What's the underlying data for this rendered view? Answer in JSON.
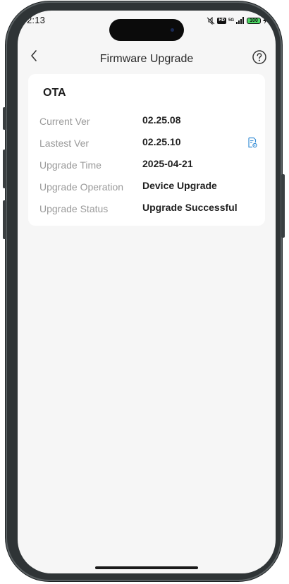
{
  "status_bar": {
    "time": "2:13",
    "network_label": "5G",
    "hd_label": "HD",
    "battery": "100"
  },
  "header": {
    "title": "Firmware Upgrade"
  },
  "ota_card": {
    "title": "OTA",
    "rows": [
      {
        "label": "Current Ver",
        "value": "02.25.08"
      },
      {
        "label": "Lastest Ver",
        "value": "02.25.10"
      },
      {
        "label": "Upgrade Time",
        "value": "2025-04-21"
      },
      {
        "label": "Upgrade Operation",
        "value": "Device Upgrade"
      },
      {
        "label": "Upgrade Status",
        "value": "Upgrade Successful"
      }
    ]
  },
  "colors": {
    "background": "#f6f6f6",
    "card": "#ffffff",
    "label": "#9a9a9a",
    "value": "#1f1f1f",
    "accent": "#3a8fd6",
    "frame": "#2f3436"
  },
  "icons": {
    "back": "chevron-left-icon",
    "help": "question-circle-icon",
    "release_notes": "document-settings-icon"
  }
}
